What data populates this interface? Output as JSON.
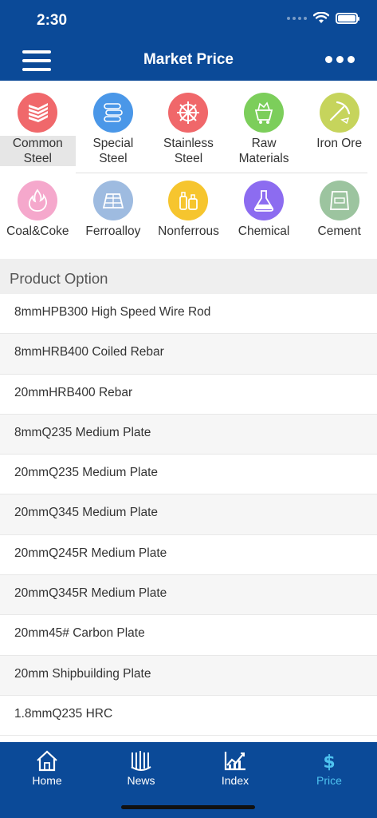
{
  "status": {
    "time": "2:30"
  },
  "nav": {
    "title": "Market Price"
  },
  "categories": [
    {
      "label": "Common\nSteel",
      "icon": "steel-sheets-icon",
      "color": "#f0686b",
      "active": true
    },
    {
      "label": "Special\nSteel",
      "icon": "steel-pipes-icon",
      "color": "#4a97e8",
      "active": false
    },
    {
      "label": "Stainless\nSteel",
      "icon": "gear-wheel-icon",
      "color": "#f0676a",
      "active": false
    },
    {
      "label": "Raw\nMaterials",
      "icon": "mine-cart-icon",
      "color": "#7cce5b",
      "active": false
    },
    {
      "label": "Iron Ore",
      "icon": "pickaxe-icon",
      "color": "#c6d45c",
      "active": false
    },
    {
      "label": "Coal&Coke",
      "icon": "fire-icon",
      "color": "#f5a8cc",
      "active": false
    },
    {
      "label": "Ferroalloy",
      "icon": "ingot-stack-icon",
      "color": "#9ebbe0",
      "active": false
    },
    {
      "label": "Nonferrous",
      "icon": "bottles-icon",
      "color": "#f6c52e",
      "active": false
    },
    {
      "label": "Chemical",
      "icon": "flask-icon",
      "color": "#8c6cf0",
      "active": false
    },
    {
      "label": "Cement",
      "icon": "cement-bag-icon",
      "color": "#9cc49f",
      "active": false
    }
  ],
  "section": {
    "title": "Product Option"
  },
  "products": [
    "8mmHPB300 High Speed Wire Rod",
    "8mmHRB400 Coiled Rebar",
    "20mmHRB400 Rebar",
    "8mmQ235 Medium Plate",
    "20mmQ235 Medium Plate",
    "20mmQ345 Medium Plate",
    "20mmQ245R Medium Plate",
    "20mmQ345R Medium Plate",
    "20mm45# Carbon Plate",
    "20mm Shipbuilding Plate",
    "1.8mmQ235 HRC"
  ],
  "tabs": [
    {
      "label": "Home",
      "icon": "home-icon",
      "active": false
    },
    {
      "label": "News",
      "icon": "news-icon",
      "active": false
    },
    {
      "label": "Index",
      "icon": "chart-icon",
      "active": false
    },
    {
      "label": "Price",
      "icon": "dollar-icon",
      "active": true
    }
  ],
  "colors": {
    "brand": "#0b4a98",
    "tab_active": "#4ec3f0"
  }
}
